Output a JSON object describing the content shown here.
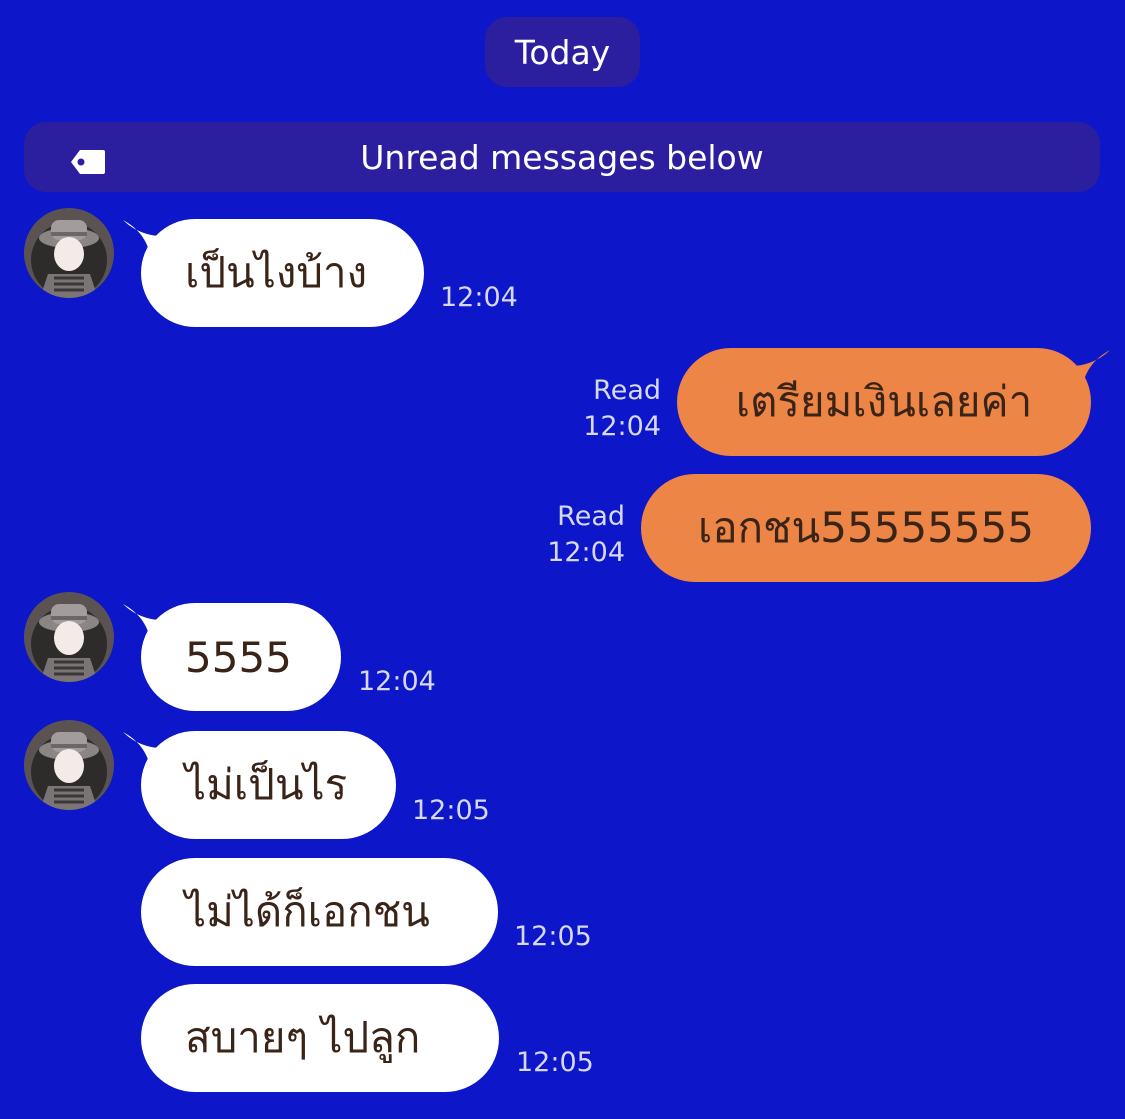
{
  "colors": {
    "background": "#0d16c8",
    "system_pill": "#2b1fa0",
    "incoming_bubble": "#ffffff",
    "outgoing_bubble": "#ec8546",
    "bubble_text": "#3a2418",
    "meta_text": "#d6d8f4"
  },
  "date_separator": "Today",
  "unread_banner": {
    "icon": "tag-icon",
    "label": "Unread messages below"
  },
  "messages": [
    {
      "direction": "incoming",
      "text": "เป็นไงบ้าง",
      "time": "12:04"
    },
    {
      "direction": "outgoing",
      "text": "เตรียมเงินเลยค่า",
      "status": "Read",
      "time": "12:04"
    },
    {
      "direction": "outgoing",
      "text": "เอกชน55555555",
      "status": "Read",
      "time": "12:04"
    },
    {
      "direction": "incoming",
      "text": "5555",
      "time": "12:04"
    },
    {
      "direction": "incoming",
      "text": "ไม่เป็นไร",
      "time": "12:05"
    },
    {
      "direction": "incoming",
      "text": "ไม่ได้ก็เอกชน",
      "time": "12:05"
    },
    {
      "direction": "incoming",
      "text": "สบายๆ ไปลูก",
      "time": "12:05"
    }
  ]
}
